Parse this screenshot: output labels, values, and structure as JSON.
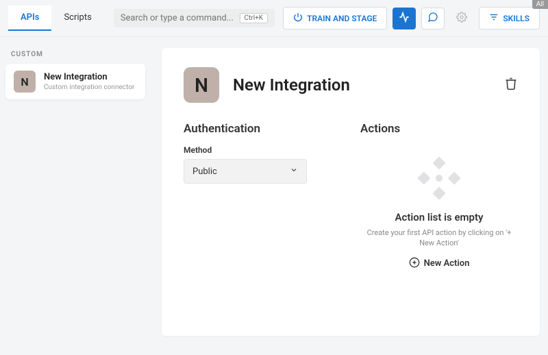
{
  "header": {
    "tabs": [
      {
        "label": "APIs",
        "active": true
      },
      {
        "label": "Scripts",
        "active": false
      }
    ],
    "search_placeholder": "Search or type a command...",
    "search_shortcut": "Ctrl+K",
    "train_button": "TRAIN AND STAGE",
    "skills_button": "SKILLS"
  },
  "corner_tag": "All",
  "sidebar": {
    "section_label": "CUSTOM",
    "items": [
      {
        "initial": "N",
        "title": "New Integration",
        "subtitle": "Custom integration connector"
      }
    ]
  },
  "main": {
    "initial": "N",
    "title": "New Integration",
    "auth_heading": "Authentication",
    "method_label": "Method",
    "method_value": "Public",
    "actions_heading": "Actions",
    "empty_title": "Action list is empty",
    "empty_text": "Create your first API action by clicking on '+ New Action'",
    "new_action_label": "New Action"
  }
}
